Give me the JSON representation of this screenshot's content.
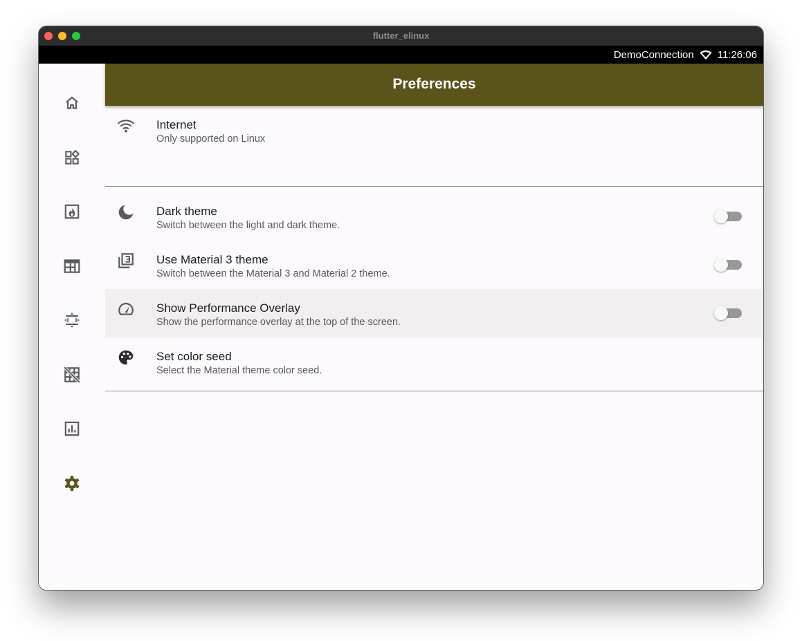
{
  "window": {
    "title": "flutter_elinux"
  },
  "status_bar": {
    "network_name": "DemoConnection",
    "time": "11:26:06"
  },
  "colors": {
    "accent": "#5a531a",
    "selected_icon": "#5a531a",
    "icon": "#5b5860",
    "highlight_row": "#f2eff1"
  },
  "rail": {
    "items": [
      {
        "icon": "home-icon",
        "selected": false
      },
      {
        "icon": "widgets-icon",
        "selected": false
      },
      {
        "icon": "fireplace-icon",
        "selected": false
      },
      {
        "icon": "web-icon",
        "selected": false
      },
      {
        "icon": "settings-overscan-icon",
        "selected": false
      },
      {
        "icon": "grid-off-icon",
        "selected": false
      },
      {
        "icon": "bar-chart-icon",
        "selected": false
      },
      {
        "icon": "gear-icon",
        "selected": true
      }
    ]
  },
  "appbar": {
    "title": "Preferences"
  },
  "settings": {
    "internet": {
      "title": "Internet",
      "subtitle": "Only supported on Linux",
      "icon": "wifi-icon"
    },
    "dark_theme": {
      "title": "Dark theme",
      "subtitle": "Switch between the light and dark theme.",
      "icon": "moon-icon",
      "enabled": false
    },
    "material3": {
      "title": "Use Material 3 theme",
      "subtitle": "Switch between the Material 3 and Material 2 theme.",
      "icon": "filter-3-icon",
      "enabled": false
    },
    "performance_overlay": {
      "title": "Show Performance Overlay",
      "subtitle": "Show the performance overlay at the top of the screen.",
      "icon": "speed-icon",
      "enabled": false
    },
    "color_seed": {
      "title": "Set color seed",
      "subtitle": "Select the Material theme color seed.",
      "icon": "palette-icon"
    }
  }
}
